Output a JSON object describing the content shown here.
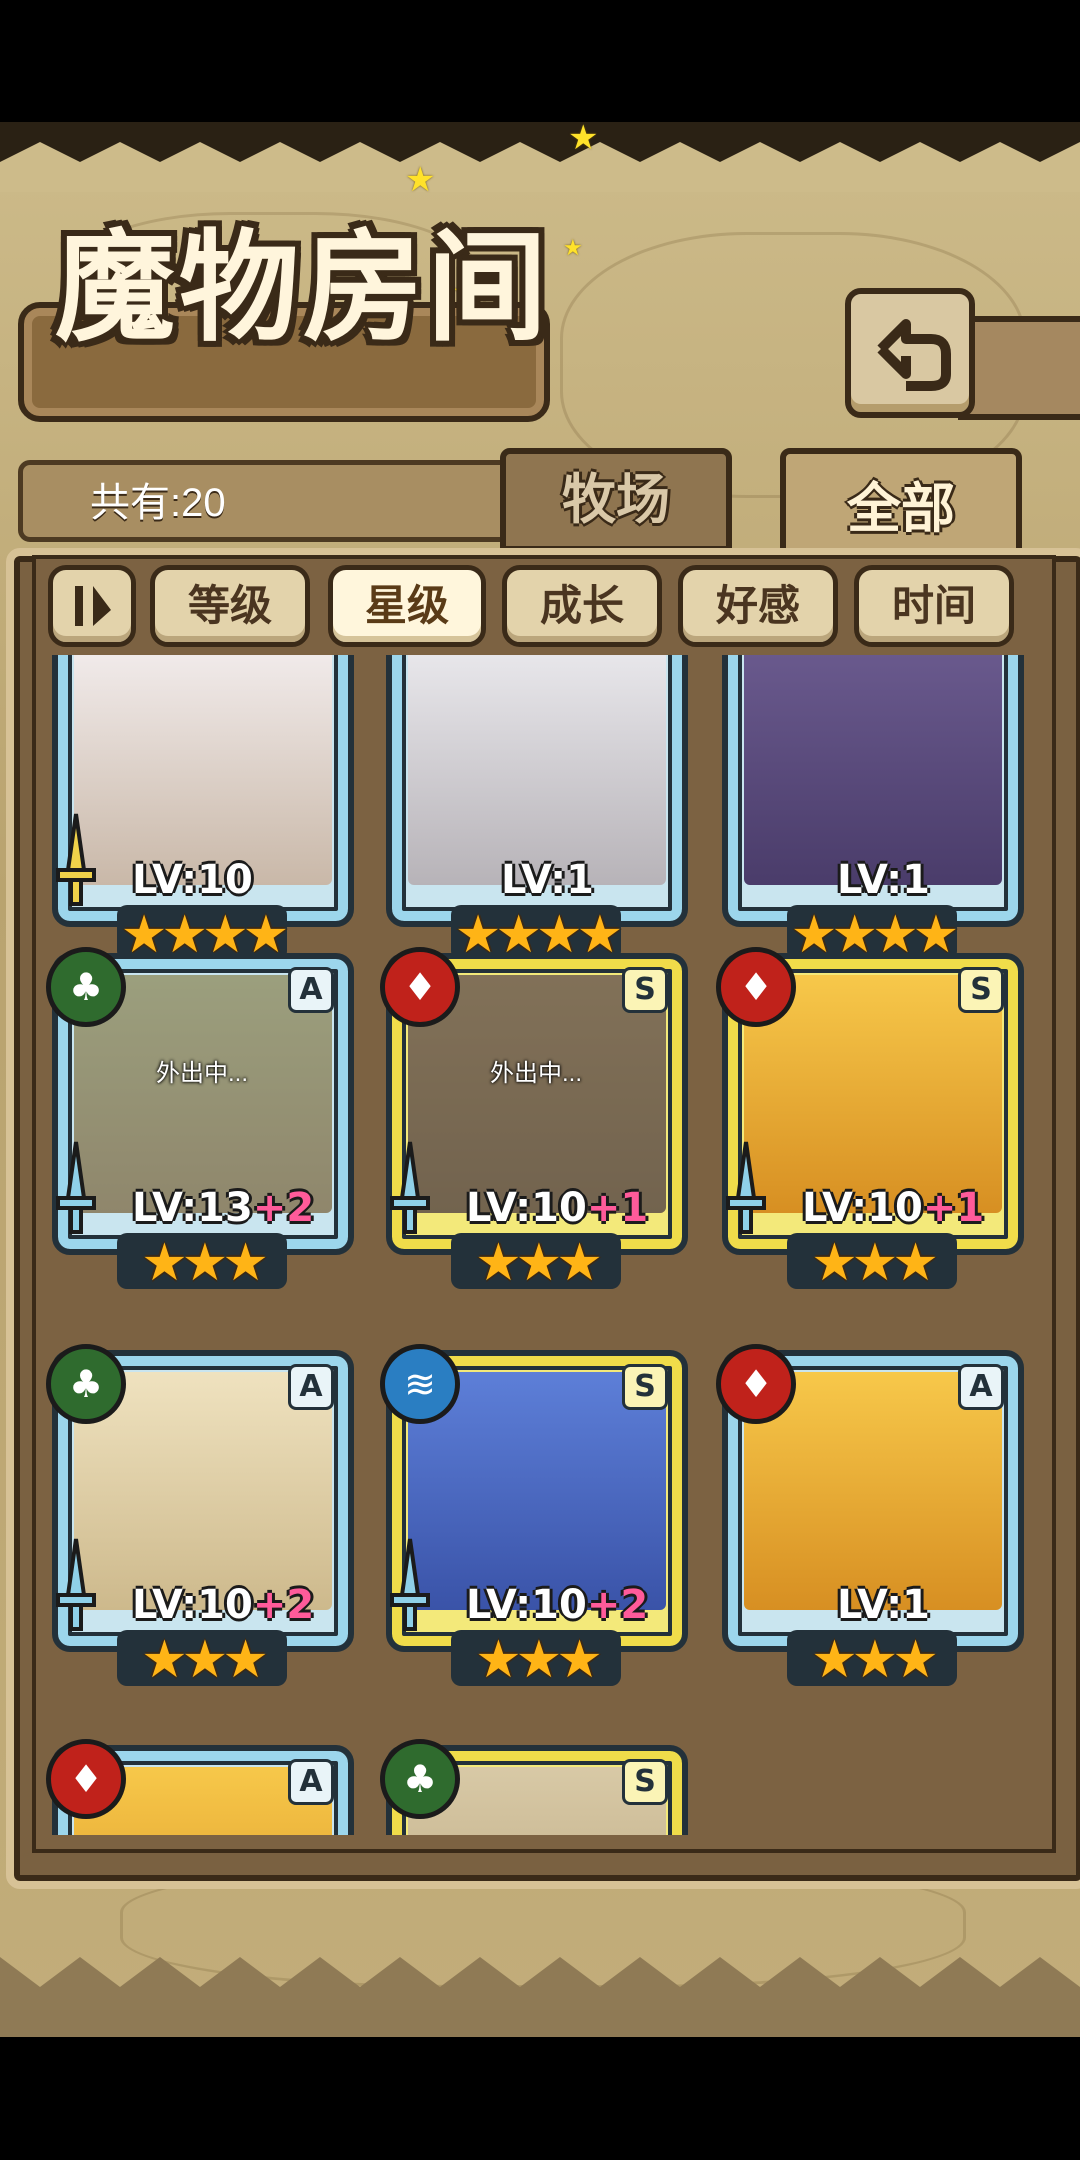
{
  "header": {
    "title": "魔物房间",
    "count_label": "共有:20"
  },
  "tabs": [
    {
      "label": "牧场",
      "active": false
    },
    {
      "label": "全部",
      "active": true
    }
  ],
  "sort": {
    "toggle_icon": "sort-toggle-icon",
    "buttons": [
      {
        "label": "等级",
        "active": false
      },
      {
        "label": "星级",
        "active": true
      },
      {
        "label": "成长",
        "active": false
      },
      {
        "label": "好感",
        "active": false
      },
      {
        "label": "时间",
        "active": false
      }
    ]
  },
  "cards": [
    {
      "level": "LV:10",
      "plus": "",
      "stars": "★★★★",
      "rank": "",
      "element": "",
      "frame": "blue",
      "away": ""
    },
    {
      "level": "LV:1",
      "plus": "",
      "stars": "★★★★",
      "rank": "",
      "element": "",
      "frame": "blue",
      "away": ""
    },
    {
      "level": "LV:1",
      "plus": "",
      "stars": "★★★★",
      "rank": "",
      "element": "",
      "frame": "blue",
      "away": ""
    },
    {
      "level": "LV:13",
      "plus": "+2",
      "stars": "★★★",
      "rank": "A",
      "element": "leaf",
      "frame": "blue",
      "away": "外出中..."
    },
    {
      "level": "LV:10",
      "plus": "+1",
      "stars": "★★★",
      "rank": "S",
      "element": "fire",
      "frame": "gold",
      "away": "外出中..."
    },
    {
      "level": "LV:10",
      "plus": "+1",
      "stars": "★★★",
      "rank": "S",
      "element": "fire",
      "frame": "gold",
      "away": ""
    },
    {
      "level": "LV:10",
      "plus": "+2",
      "stars": "★★★",
      "rank": "A",
      "element": "leaf",
      "frame": "blue",
      "away": ""
    },
    {
      "level": "LV:10",
      "plus": "+2",
      "stars": "★★★",
      "rank": "S",
      "element": "water",
      "frame": "gold",
      "away": ""
    },
    {
      "level": "LV:1",
      "plus": "",
      "stars": "★★★",
      "rank": "A",
      "element": "fire",
      "frame": "blue",
      "away": ""
    },
    {
      "level": "",
      "plus": "",
      "stars": "",
      "rank": "A",
      "element": "fire",
      "frame": "blue",
      "away": ""
    },
    {
      "level": "",
      "plus": "",
      "stars": "",
      "rank": "S",
      "element": "leaf",
      "frame": "gold",
      "away": ""
    }
  ],
  "colors": {
    "leaf": "#2f6b2e",
    "fire": "#c0221b",
    "water": "#2a7ec2",
    "blue_frame": "#9cd6ec",
    "gold_frame": "#f0dc4a"
  }
}
